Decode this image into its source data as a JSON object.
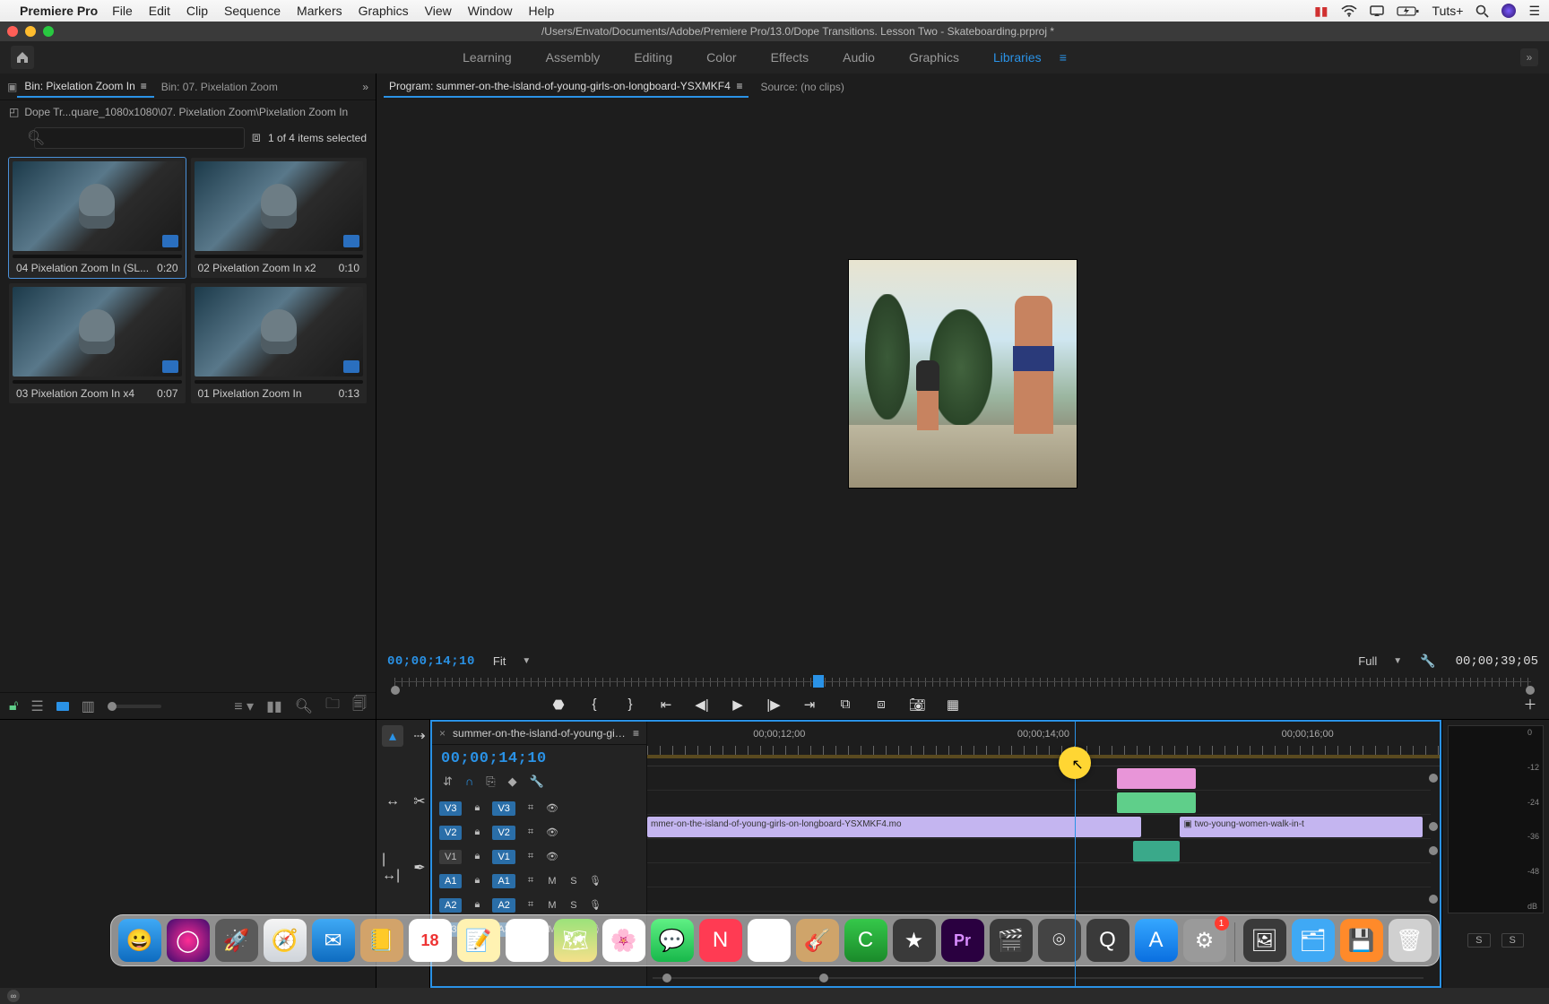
{
  "menubar": {
    "app_name": "Premiere Pro",
    "items": [
      "File",
      "Edit",
      "Clip",
      "Sequence",
      "Markers",
      "Graphics",
      "View",
      "Window",
      "Help"
    ],
    "right": {
      "account": "Tuts+"
    }
  },
  "window": {
    "title": "/Users/Envato/Documents/Adobe/Premiere Pro/13.0/Dope Transitions. Lesson Two - Skateboarding.prproj *"
  },
  "workspaces": {
    "items": [
      "Learning",
      "Assembly",
      "Editing",
      "Color",
      "Effects",
      "Audio",
      "Graphics",
      "Libraries"
    ],
    "active": "Libraries"
  },
  "project": {
    "tab_active": "Bin: Pixelation Zoom In",
    "tab_inactive": "Bin: 07. Pixelation Zoom",
    "breadcrumb": "Dope Tr...quare_1080x1080\\07. Pixelation Zoom\\Pixelation Zoom In",
    "search_placeholder": "",
    "selection_status": "1 of 4 items selected",
    "thumbs": [
      {
        "name": "04 Pixelation Zoom In (SL...",
        "dur": "0:20",
        "selected": true
      },
      {
        "name": "02 Pixelation Zoom In x2",
        "dur": "0:10",
        "selected": false
      },
      {
        "name": "03 Pixelation Zoom In x4",
        "dur": "0:07",
        "selected": false
      },
      {
        "name": "01 Pixelation Zoom In",
        "dur": "0:13",
        "selected": false
      }
    ]
  },
  "program": {
    "tab_active": "Program: summer-on-the-island-of-young-girls-on-longboard-YSXMKF4",
    "tab_inactive": "Source: (no clips)",
    "timecode": "00;00;14;10",
    "zoom": "Fit",
    "quality": "Full",
    "duration": "00;00;39;05"
  },
  "timeline": {
    "seq_name": "summer-on-the-island-of-young-girls-on-longboard-YSXMKF4",
    "timecode": "00;00;14;10",
    "ruler": [
      "00;00;12;00",
      "00;00;14;00",
      "00;00;16;00"
    ],
    "video_tracks": [
      {
        "src": "V3",
        "tgt": "V3",
        "source_on": true
      },
      {
        "src": "V2",
        "tgt": "V2",
        "source_on": true
      },
      {
        "src": "V1",
        "tgt": "V1",
        "source_on": false
      }
    ],
    "audio_tracks": [
      {
        "src": "A1",
        "tgt": "A1"
      },
      {
        "src": "A2",
        "tgt": "A2"
      },
      {
        "src": "A3",
        "tgt": "A3"
      }
    ],
    "audio_labels": {
      "m": "M",
      "s": "S"
    },
    "clips": {
      "v1_a": "mmer-on-the-island-of-young-girls-on-longboard-YSXMKF4.mo",
      "v1_b": "two-young-women-walk-in-t"
    }
  },
  "meters": {
    "scale": [
      "0",
      "-12",
      "-24",
      "-36",
      "-48",
      "dB"
    ],
    "solo": "S"
  },
  "dock": {
    "cal_day": "18",
    "badge_sys": "1"
  }
}
